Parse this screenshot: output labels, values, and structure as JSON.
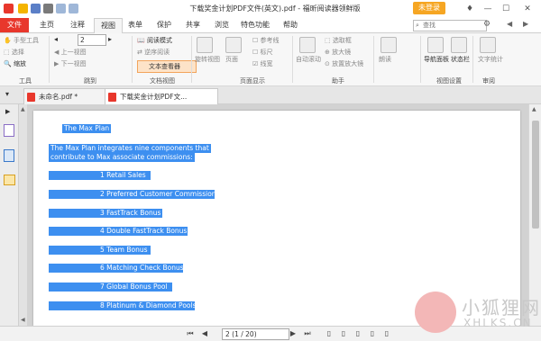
{
  "titlebar": {
    "title": "下载奖金计划PDF文件(英文).pdf - 福昕阅读器领鲜版",
    "login": "未登录",
    "controls": [
      "—",
      "☐",
      "✕"
    ]
  },
  "menu": {
    "tabs": [
      "文件",
      "主页",
      "注释",
      "视图",
      "表单",
      "保护",
      "共享",
      "浏览",
      "特色功能",
      "帮助"
    ],
    "active": "视图",
    "search_placeholder": "查找"
  },
  "ribbon": {
    "tools": {
      "label": "工具",
      "hand": "手型工具",
      "select": "选择",
      "zoom": "缩放"
    },
    "nav": {
      "label": "跳到",
      "page": "2",
      "prev": "上一视图",
      "next": "下一视图"
    },
    "docview": {
      "label": "文档视图",
      "reading": "阅读模式",
      "reverse": "逆序阅读",
      "text_viewer": "文本查看器"
    },
    "pagedisplay": {
      "label": "页面显示",
      "rotate": "旋转视图",
      "layout": "页面",
      "ref": "参考线",
      "ruler": "标尺",
      "lineweight": "线宽"
    },
    "assist": {
      "label": "助手",
      "autoscroll": "自动滚动",
      "marquee": "选取框",
      "magnifier": "放大镜",
      "loupe": "放置放大镜"
    },
    "read": {
      "label": "朗读"
    },
    "viewset": {
      "label": "视图设置",
      "navpanel": "导航面板",
      "statusbar": "状态栏"
    },
    "region": {
      "label": "审阅",
      "text_size": "文字统计"
    }
  },
  "doctabs": [
    "未命名.pdf *",
    "下载奖金计划PDF文..."
  ],
  "document": {
    "heading": "The  Max Plan",
    "intro": [
      "The Max Plan integrates nine components that",
      "contribute to Max associate commissions:"
    ],
    "items": [
      "1    Retail Sales",
      "2    Preferred Customer Commissions",
      "3   FastTrack Bonus",
      "4    Double FastTrack Bonus",
      "5    Team Bonus",
      "6    Matching Check Bonus",
      "7    Global Bonus Pool",
      "8    Platinum & Diamond Pools"
    ]
  },
  "status": {
    "page_display": "2 (1 / 20)"
  },
  "watermark": {
    "name": "小狐狸网",
    "url": "XHLKS.CN"
  }
}
